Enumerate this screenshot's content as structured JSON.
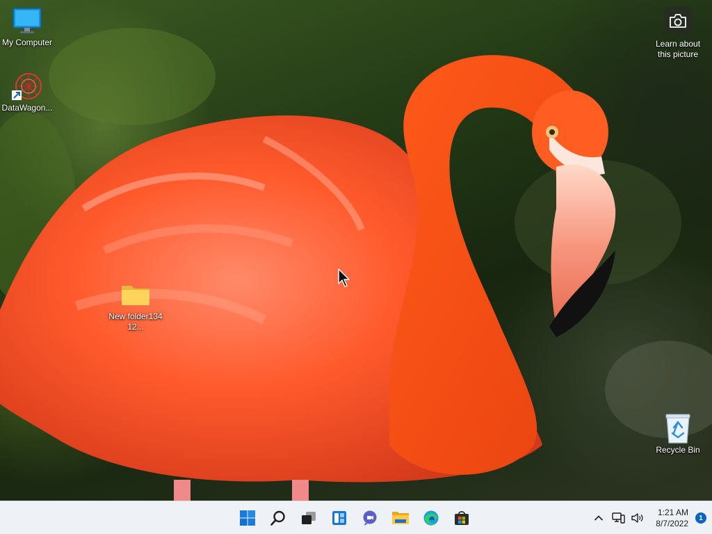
{
  "desktop": {
    "icons": [
      {
        "label": "My Computer",
        "icon": "monitor-icon"
      },
      {
        "label": "DataWagon...",
        "icon": "datawagon-shortcut-icon"
      },
      {
        "label": "New folder13412...",
        "icon": "folder-icon"
      },
      {
        "label": "Recycle Bin",
        "icon": "recycle-bin-icon"
      }
    ],
    "spotlight": {
      "label": "Learn about this picture",
      "icon": "camera-icon"
    }
  },
  "taskbar": {
    "apps": [
      {
        "name": "Start",
        "icon": "windows-start-icon"
      },
      {
        "name": "Search",
        "icon": "search-icon"
      },
      {
        "name": "Task View",
        "icon": "task-view-icon"
      },
      {
        "name": "Widgets",
        "icon": "widgets-icon"
      },
      {
        "name": "Chat",
        "icon": "chat-icon"
      },
      {
        "name": "File Explorer",
        "icon": "file-explorer-icon"
      },
      {
        "name": "Microsoft Edge",
        "icon": "edge-icon"
      },
      {
        "name": "Microsoft Store",
        "icon": "store-icon"
      }
    ],
    "tray": {
      "icons": [
        "chevron-up-icon",
        "network-icon",
        "speaker-icon"
      ],
      "time": "1:21 AM",
      "date": "8/7/2022",
      "notification_count": "1"
    }
  },
  "colors": {
    "taskbar_bg": "#eef1f6",
    "accent": "#0a64c2",
    "flamingo": "#ff5a1f"
  }
}
